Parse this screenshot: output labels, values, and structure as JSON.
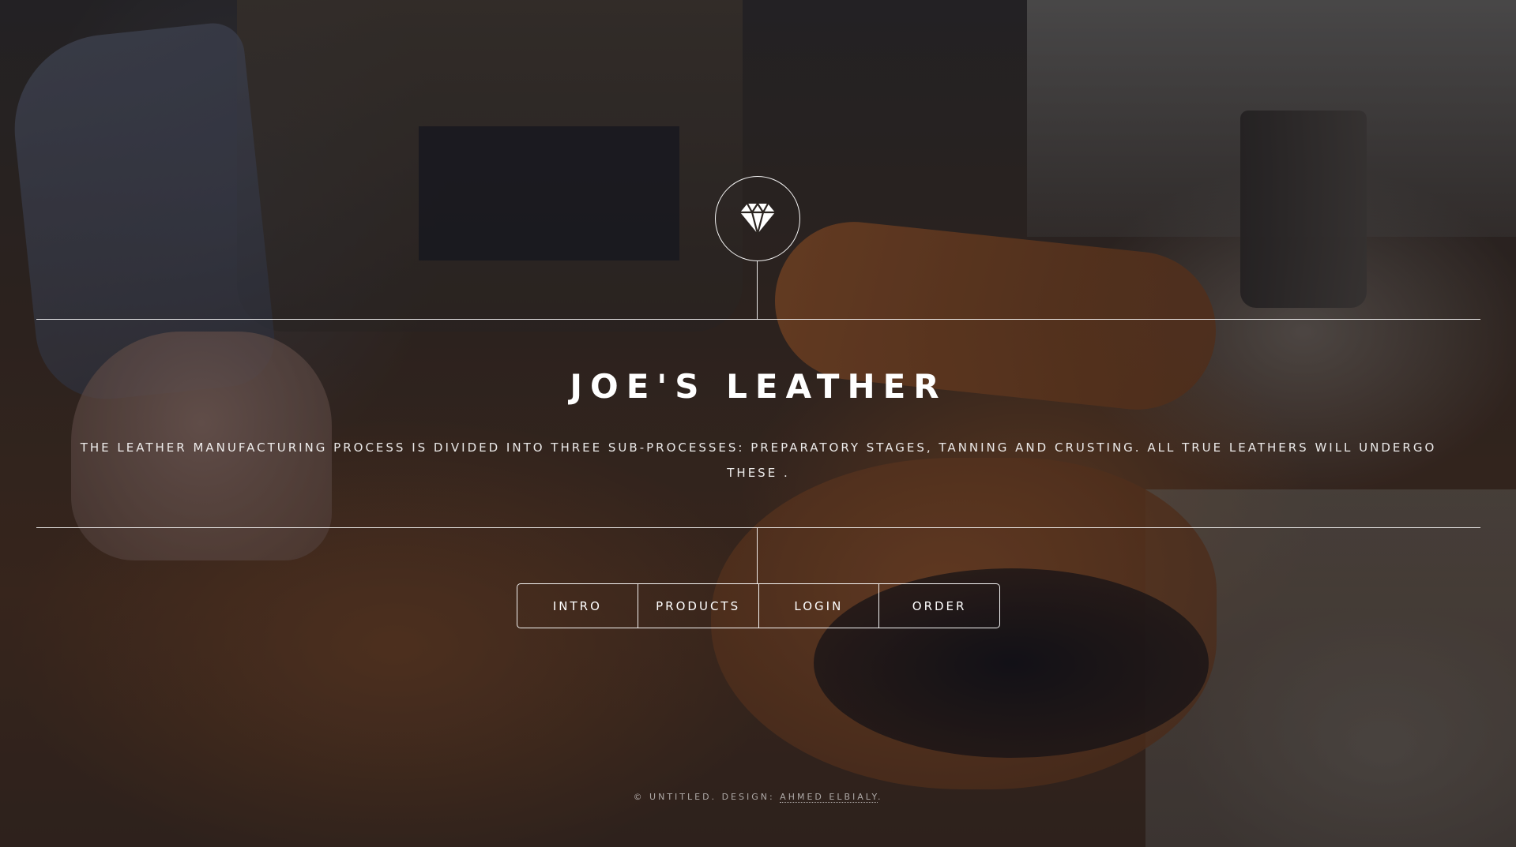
{
  "header": {
    "logo_icon": "diamond-icon"
  },
  "main": {
    "title": "JOE'S LEATHER",
    "tagline": "THE LEATHER MANUFACTURING PROCESS IS DIVIDED INTO THREE SUB-PROCESSES: PREPARATORY STAGES, TANNING AND CRUSTING. ALL TRUE LEATHERS WILL UNDERGO THESE ."
  },
  "nav": {
    "items": [
      {
        "label": "INTRO"
      },
      {
        "label": "PRODUCTS"
      },
      {
        "label": "LOGIN"
      },
      {
        "label": "ORDER"
      }
    ]
  },
  "footer": {
    "prefix": "© UNTITLED. DESIGN: ",
    "link_label": "AHMED ELBIALY",
    "suffix": "."
  },
  "colors": {
    "text": "#ffffff",
    "leather_accent": "#8a5028"
  }
}
